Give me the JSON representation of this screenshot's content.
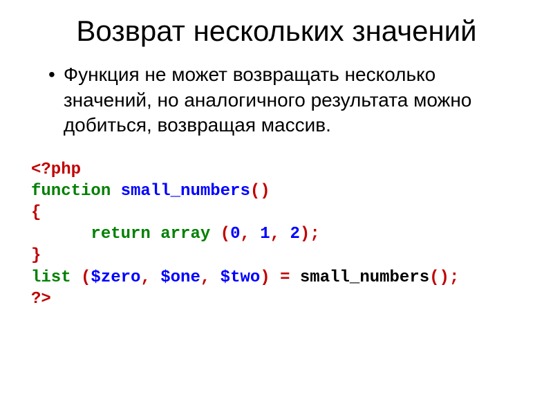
{
  "header": {
    "title": "Возврат нескольких значений"
  },
  "bullet": {
    "marker": "•",
    "text": "Функция не может возвращать несколько значений, но аналогичного результата можно добиться, возвращая массив."
  },
  "code": {
    "line1_open": "<?php",
    "line2_kw": "function",
    "line2_name": " small_numbers",
    "line2_paren": "()",
    "line3": "{",
    "line4_indent": "      ",
    "line4_kw": "return",
    "line4_sp1": " ",
    "line4_fn": "array",
    "line4_sp2": " ",
    "line4_popen": "(",
    "line4_n0": "0",
    "line4_c1": ",",
    "line4_sp3": " ",
    "line4_n1": "1",
    "line4_c2": ",",
    "line4_sp4": " ",
    "line4_n2": "2",
    "line4_pclose": ")",
    "line4_semi": ";",
    "line5": "}",
    "line6_kw": "list",
    "line6_sp1": " ",
    "line6_popen": "(",
    "line6_v1": "$zero",
    "line6_c1": ",",
    "line6_sp2": " ",
    "line6_v2": "$one",
    "line6_c2": ",",
    "line6_sp3": " ",
    "line6_v3": "$two",
    "line6_pclose": ")",
    "line6_sp4": " ",
    "line6_eq": "=",
    "line6_sp5": " ",
    "line6_call": "small_numbers",
    "line6_cparen": "()",
    "line6_semi": ";",
    "line7_close": "?>"
  }
}
